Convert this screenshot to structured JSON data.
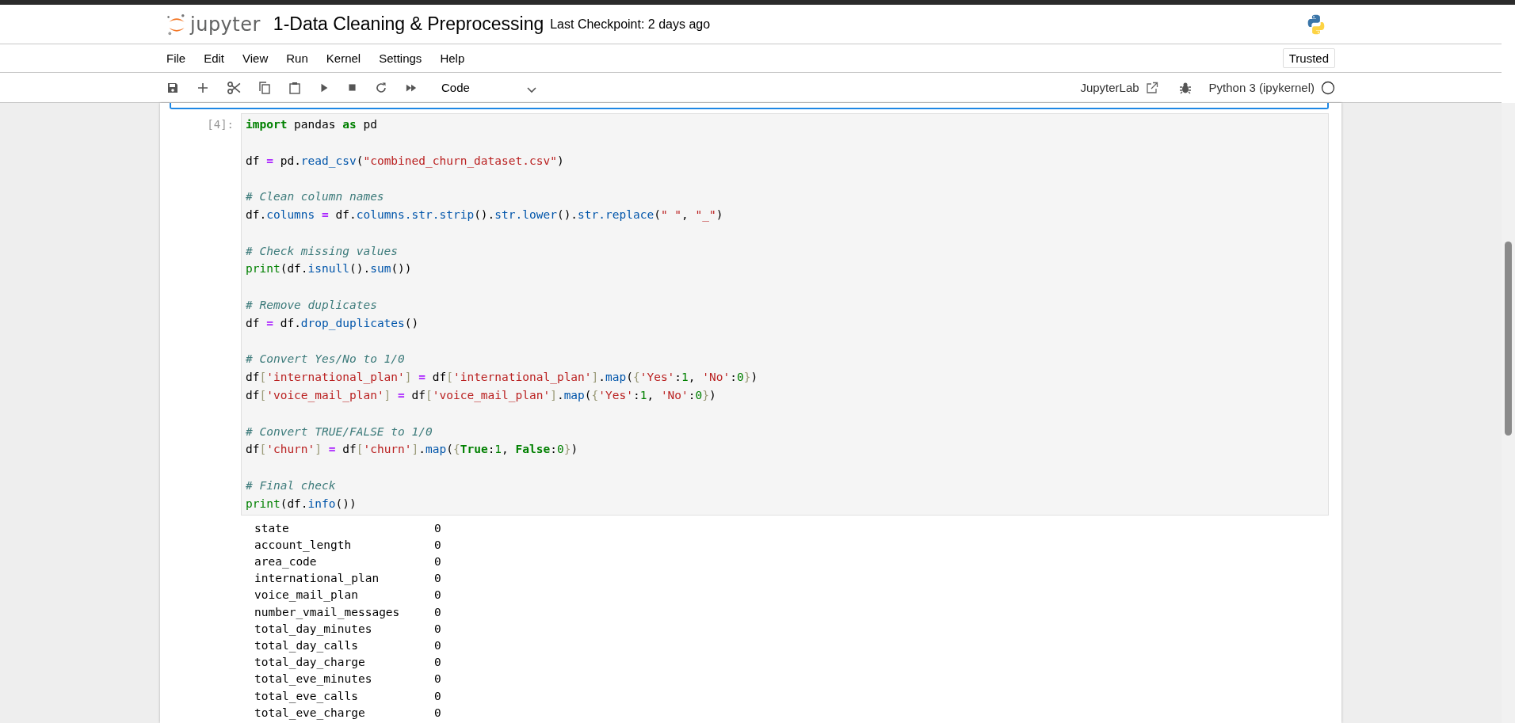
{
  "header": {
    "logo_text": "jupyter",
    "title": "1-Data Cleaning & Preprocessing",
    "checkpoint": "Last Checkpoint: 2 days ago"
  },
  "menu": [
    "File",
    "Edit",
    "View",
    "Run",
    "Kernel",
    "Settings",
    "Help"
  ],
  "trusted": {
    "label": "Trusted"
  },
  "toolbar": {
    "cell_type": "Code",
    "lab_link": "JupyterLab",
    "kernel": "Python 3 (ipykernel)",
    "kernel_busy": false
  },
  "cell": {
    "prompt": "[4]:",
    "lines": [
      {
        "gap_after": true,
        "tokens": [
          {
            "kind": "kw",
            "text": "import"
          },
          {
            "kind": "plain",
            "text": " pandas "
          },
          {
            "kind": "kw",
            "text": "as"
          },
          {
            "kind": "plain",
            "text": " pd"
          }
        ]
      },
      {
        "gap_after": true,
        "tokens": [
          {
            "kind": "plain",
            "text": "df "
          },
          {
            "kind": "op",
            "text": "="
          },
          {
            "kind": "plain",
            "text": " pd."
          },
          {
            "kind": "attr",
            "text": "read_csv"
          },
          {
            "kind": "plain",
            "text": "("
          },
          {
            "kind": "str",
            "text": "\"combined_churn_dataset.csv\""
          },
          {
            "kind": "plain",
            "text": ")"
          }
        ]
      },
      {
        "gap_after": false,
        "tokens": [
          {
            "kind": "comment",
            "text": "# Clean column names"
          }
        ]
      },
      {
        "gap_after": true,
        "tokens": [
          {
            "kind": "plain",
            "text": "df."
          },
          {
            "kind": "attr",
            "text": "columns"
          },
          {
            "kind": "op",
            "text": " = "
          },
          {
            "kind": "plain",
            "text": "df."
          },
          {
            "kind": "attr",
            "text": "columns.str.strip"
          },
          {
            "kind": "plain",
            "text": "()."
          },
          {
            "kind": "attr",
            "text": "str.lower"
          },
          {
            "kind": "plain",
            "text": "()."
          },
          {
            "kind": "attr",
            "text": "str.replace"
          },
          {
            "kind": "plain",
            "text": "("
          },
          {
            "kind": "str",
            "text": "\" \""
          },
          {
            "kind": "plain",
            "text": ", "
          },
          {
            "kind": "str",
            "text": "\"_\""
          },
          {
            "kind": "plain",
            "text": ")"
          }
        ]
      },
      {
        "gap_after": false,
        "tokens": [
          {
            "kind": "comment",
            "text": "# Check missing values"
          }
        ]
      },
      {
        "gap_after": true,
        "tokens": [
          {
            "kind": "builtin",
            "text": "print"
          },
          {
            "kind": "plain",
            "text": "(df."
          },
          {
            "kind": "attr",
            "text": "isnull"
          },
          {
            "kind": "plain",
            "text": "()."
          },
          {
            "kind": "attr",
            "text": "sum"
          },
          {
            "kind": "plain",
            "text": "())"
          }
        ]
      },
      {
        "gap_after": false,
        "tokens": [
          {
            "kind": "comment",
            "text": "# Remove duplicates"
          }
        ]
      },
      {
        "gap_after": true,
        "tokens": [
          {
            "kind": "plain",
            "text": "df "
          },
          {
            "kind": "op",
            "text": "="
          },
          {
            "kind": "plain",
            "text": " df."
          },
          {
            "kind": "attr",
            "text": "drop_duplicates"
          },
          {
            "kind": "plain",
            "text": "()"
          }
        ]
      },
      {
        "gap_after": false,
        "tokens": [
          {
            "kind": "comment",
            "text": "# Convert Yes/No to 1/0"
          }
        ]
      },
      {
        "gap_after": false,
        "tokens": [
          {
            "kind": "plain",
            "text": "df"
          },
          {
            "kind": "bracket",
            "text": "["
          },
          {
            "kind": "str",
            "text": "'international_plan'"
          },
          {
            "kind": "bracket",
            "text": "]"
          },
          {
            "kind": "op",
            "text": " = "
          },
          {
            "kind": "plain",
            "text": "df"
          },
          {
            "kind": "bracket",
            "text": "["
          },
          {
            "kind": "str",
            "text": "'international_plan'"
          },
          {
            "kind": "bracket",
            "text": "]"
          },
          {
            "kind": "plain",
            "text": "."
          },
          {
            "kind": "attr",
            "text": "map"
          },
          {
            "kind": "plain",
            "text": "("
          },
          {
            "kind": "bracket",
            "text": "{"
          },
          {
            "kind": "str",
            "text": "'Yes'"
          },
          {
            "kind": "plain",
            "text": ":"
          },
          {
            "kind": "num",
            "text": "1"
          },
          {
            "kind": "plain",
            "text": ", "
          },
          {
            "kind": "str",
            "text": "'No'"
          },
          {
            "kind": "plain",
            "text": ":"
          },
          {
            "kind": "num",
            "text": "0"
          },
          {
            "kind": "bracket",
            "text": "}"
          },
          {
            "kind": "plain",
            "text": ")"
          }
        ]
      },
      {
        "gap_after": true,
        "tokens": [
          {
            "kind": "plain",
            "text": "df"
          },
          {
            "kind": "bracket",
            "text": "["
          },
          {
            "kind": "str",
            "text": "'voice_mail_plan'"
          },
          {
            "kind": "bracket",
            "text": "]"
          },
          {
            "kind": "op",
            "text": " = "
          },
          {
            "kind": "plain",
            "text": "df"
          },
          {
            "kind": "bracket",
            "text": "["
          },
          {
            "kind": "str",
            "text": "'voice_mail_plan'"
          },
          {
            "kind": "bracket",
            "text": "]"
          },
          {
            "kind": "plain",
            "text": "."
          },
          {
            "kind": "attr",
            "text": "map"
          },
          {
            "kind": "plain",
            "text": "("
          },
          {
            "kind": "bracket",
            "text": "{"
          },
          {
            "kind": "str",
            "text": "'Yes'"
          },
          {
            "kind": "plain",
            "text": ":"
          },
          {
            "kind": "num",
            "text": "1"
          },
          {
            "kind": "plain",
            "text": ", "
          },
          {
            "kind": "str",
            "text": "'No'"
          },
          {
            "kind": "plain",
            "text": ":"
          },
          {
            "kind": "num",
            "text": "0"
          },
          {
            "kind": "bracket",
            "text": "}"
          },
          {
            "kind": "plain",
            "text": ")"
          }
        ]
      },
      {
        "gap_after": false,
        "tokens": [
          {
            "kind": "comment",
            "text": "# Convert TRUE/FALSE to 1/0"
          }
        ]
      },
      {
        "gap_after": true,
        "tokens": [
          {
            "kind": "plain",
            "text": "df"
          },
          {
            "kind": "bracket",
            "text": "["
          },
          {
            "kind": "str",
            "text": "'churn'"
          },
          {
            "kind": "bracket",
            "text": "]"
          },
          {
            "kind": "op",
            "text": " = "
          },
          {
            "kind": "plain",
            "text": "df"
          },
          {
            "kind": "bracket",
            "text": "["
          },
          {
            "kind": "str",
            "text": "'churn'"
          },
          {
            "kind": "bracket",
            "text": "]"
          },
          {
            "kind": "plain",
            "text": "."
          },
          {
            "kind": "attr",
            "text": "map"
          },
          {
            "kind": "plain",
            "text": "("
          },
          {
            "kind": "bracket",
            "text": "{"
          },
          {
            "kind": "kw",
            "text": "True"
          },
          {
            "kind": "plain",
            "text": ":"
          },
          {
            "kind": "num",
            "text": "1"
          },
          {
            "kind": "plain",
            "text": ", "
          },
          {
            "kind": "kw",
            "text": "False"
          },
          {
            "kind": "plain",
            "text": ":"
          },
          {
            "kind": "num",
            "text": "0"
          },
          {
            "kind": "bracket",
            "text": "}"
          },
          {
            "kind": "plain",
            "text": ")"
          }
        ]
      },
      {
        "gap_after": false,
        "tokens": [
          {
            "kind": "comment",
            "text": "# Final check"
          }
        ]
      },
      {
        "gap_after": false,
        "tokens": [
          {
            "kind": "builtin",
            "text": "print"
          },
          {
            "kind": "plain",
            "text": "(df."
          },
          {
            "kind": "attr",
            "text": "info"
          },
          {
            "kind": "plain",
            "text": "())"
          }
        ]
      }
    ]
  },
  "output": [
    {
      "name": "state",
      "value": "0"
    },
    {
      "name": "account_length",
      "value": "0"
    },
    {
      "name": "area_code",
      "value": "0"
    },
    {
      "name": "international_plan",
      "value": "0"
    },
    {
      "name": "voice_mail_plan",
      "value": "0"
    },
    {
      "name": "number_vmail_messages",
      "value": "0"
    },
    {
      "name": "total_day_minutes",
      "value": "0"
    },
    {
      "name": "total_day_calls",
      "value": "0"
    },
    {
      "name": "total_day_charge",
      "value": "0"
    },
    {
      "name": "total_eve_minutes",
      "value": "0"
    },
    {
      "name": "total_eve_calls",
      "value": "0"
    },
    {
      "name": "total_eve_charge",
      "value": "0"
    }
  ]
}
